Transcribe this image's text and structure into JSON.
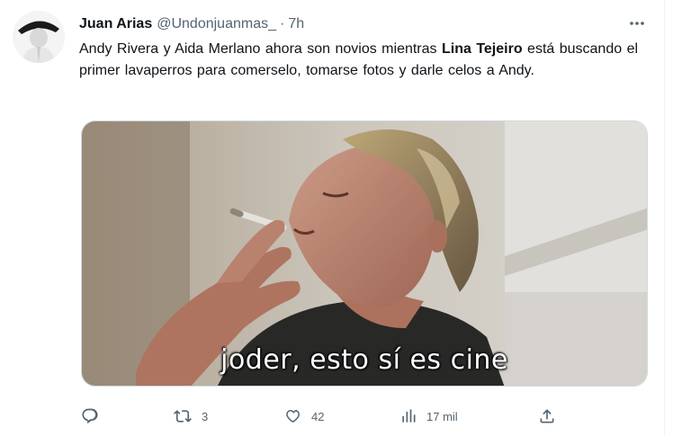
{
  "tweet": {
    "display_name": "Juan Arias",
    "handle": "@Undonjuanmas_",
    "separator": "·",
    "time": "7h",
    "text": {
      "part1": "Andy Rivera y Aida Merlano ahora son novios mientras ",
      "bold": "Lina Tejeiro",
      "part2": " está buscando el primer lavaperros para comerselo, tomarse fotos y darle celos a Andy."
    },
    "media_caption": "joder, esto sí es cine"
  },
  "actions": {
    "reply_count": "",
    "retweet_count": "3",
    "like_count": "42",
    "views_count": "17 mil"
  },
  "icons": {
    "more": "more-horizontal-icon",
    "reply": "reply-icon",
    "retweet": "retweet-icon",
    "like": "heart-icon",
    "views": "views-icon",
    "share": "share-icon"
  },
  "colors": {
    "text": "#0f1419",
    "secondary": "#536471",
    "border": "#cfd9de"
  }
}
